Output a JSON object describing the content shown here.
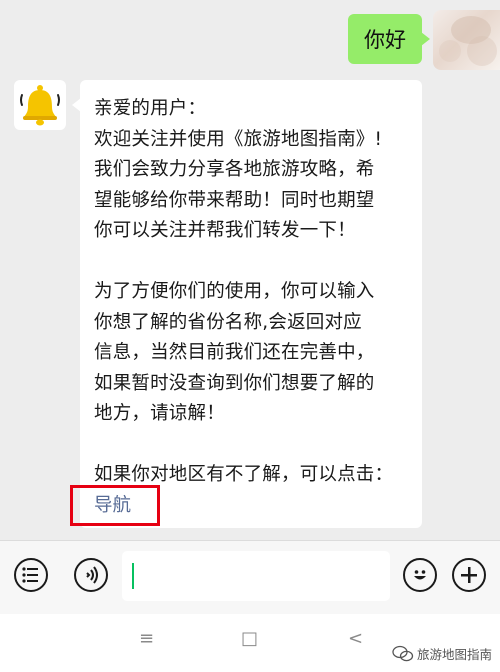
{
  "outgoing": {
    "text": "你好"
  },
  "incoming": {
    "lines": [
      "亲爱的用户：",
      "欢迎关注并使用《旅游地图指南》!",
      "我们会致力分享各地旅游攻略，希",
      "望能够给你带来帮助！同时也期望",
      "你可以关注并帮我们转发一下！",
      "",
      "为了方便你们的使用，你可以输入",
      "你想了解的省份名称,会返回对应",
      "信息，当然目前我们还在完善中，",
      "如果暂时没查询到你们想要了解的",
      "地方，请谅解！",
      "",
      "如果你对地区有不了解，可以点击："
    ],
    "link_text": "导航"
  },
  "input_bar": {
    "left_icons": [
      "list-icon",
      "voice-icon"
    ],
    "right_icons": [
      "emoji-icon",
      "plus-icon"
    ]
  },
  "system_nav": {
    "menu": "≡",
    "home": "□",
    "back": "<"
  },
  "watermark": {
    "text": "旅游地图指南"
  },
  "colors": {
    "outgoing_bubble": "#95ec69",
    "link": "#576b95",
    "highlight_box": "#e60012",
    "bell": "#f5c400"
  }
}
